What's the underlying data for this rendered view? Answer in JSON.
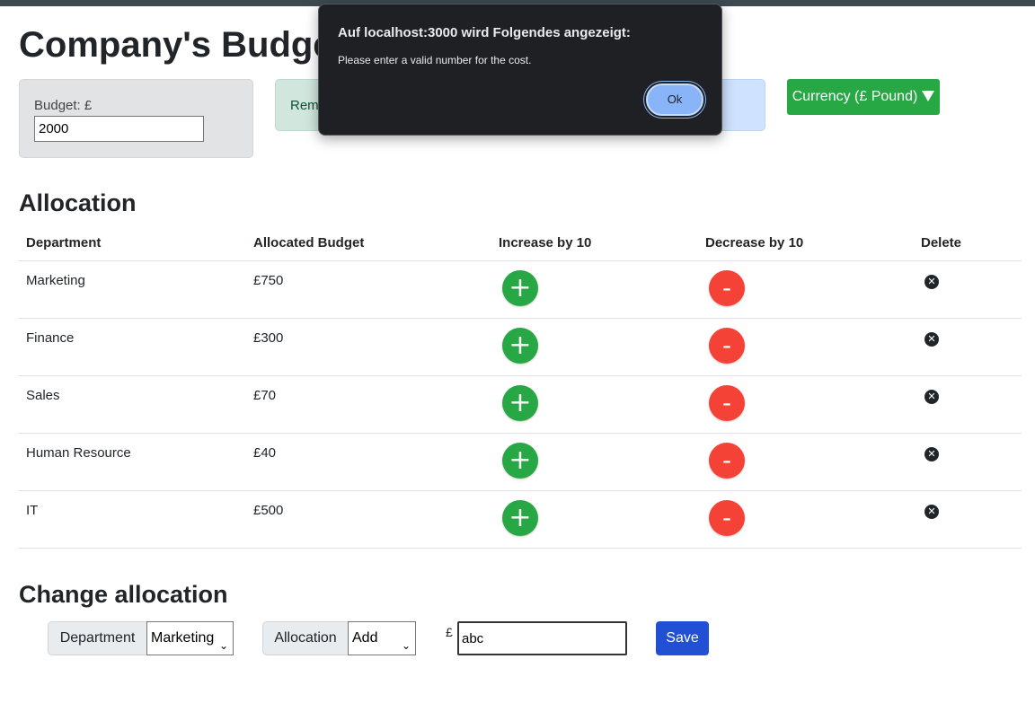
{
  "page": {
    "title": "Company's Budget",
    "budget_label": "Budget: £",
    "budget_value": "2000",
    "remaining_label": "Rem",
    "currency_button": "Currency (£ Pound)"
  },
  "allocation": {
    "title": "Allocation",
    "headers": [
      "Department",
      "Allocated Budget",
      "Increase by 10",
      "Decrease by 10",
      "Delete"
    ],
    "rows": [
      {
        "department": "Marketing",
        "budget": "£750"
      },
      {
        "department": "Finance",
        "budget": "£300"
      },
      {
        "department": "Sales",
        "budget": "£70"
      },
      {
        "department": "Human Resource",
        "budget": "£40"
      },
      {
        "department": "IT",
        "budget": "£500"
      }
    ],
    "plus_symbol": "+",
    "minus_symbol": "-",
    "delete_symbol": "✕"
  },
  "change_allocation": {
    "title": "Change allocation",
    "department_label": "Department",
    "department_selected": "Marketing",
    "allocation_label": "Allocation",
    "allocation_selected": "Add",
    "currency_symbol": "£",
    "cost_value": "abc",
    "save_label": "Save"
  },
  "dialog": {
    "title": "Auf localhost:3000 wird Folgendes angezeigt:",
    "message": "Please enter a valid number for the cost.",
    "ok_label": "Ok"
  },
  "colors": {
    "increase": "#28a745",
    "decrease": "#f44336",
    "save": "#2150d4",
    "currency": "#28a745"
  },
  "icons": {
    "increase": "plus-icon",
    "decrease": "minus-icon",
    "delete": "delete-circle-icon",
    "dropdown": "caret-down-icon"
  }
}
